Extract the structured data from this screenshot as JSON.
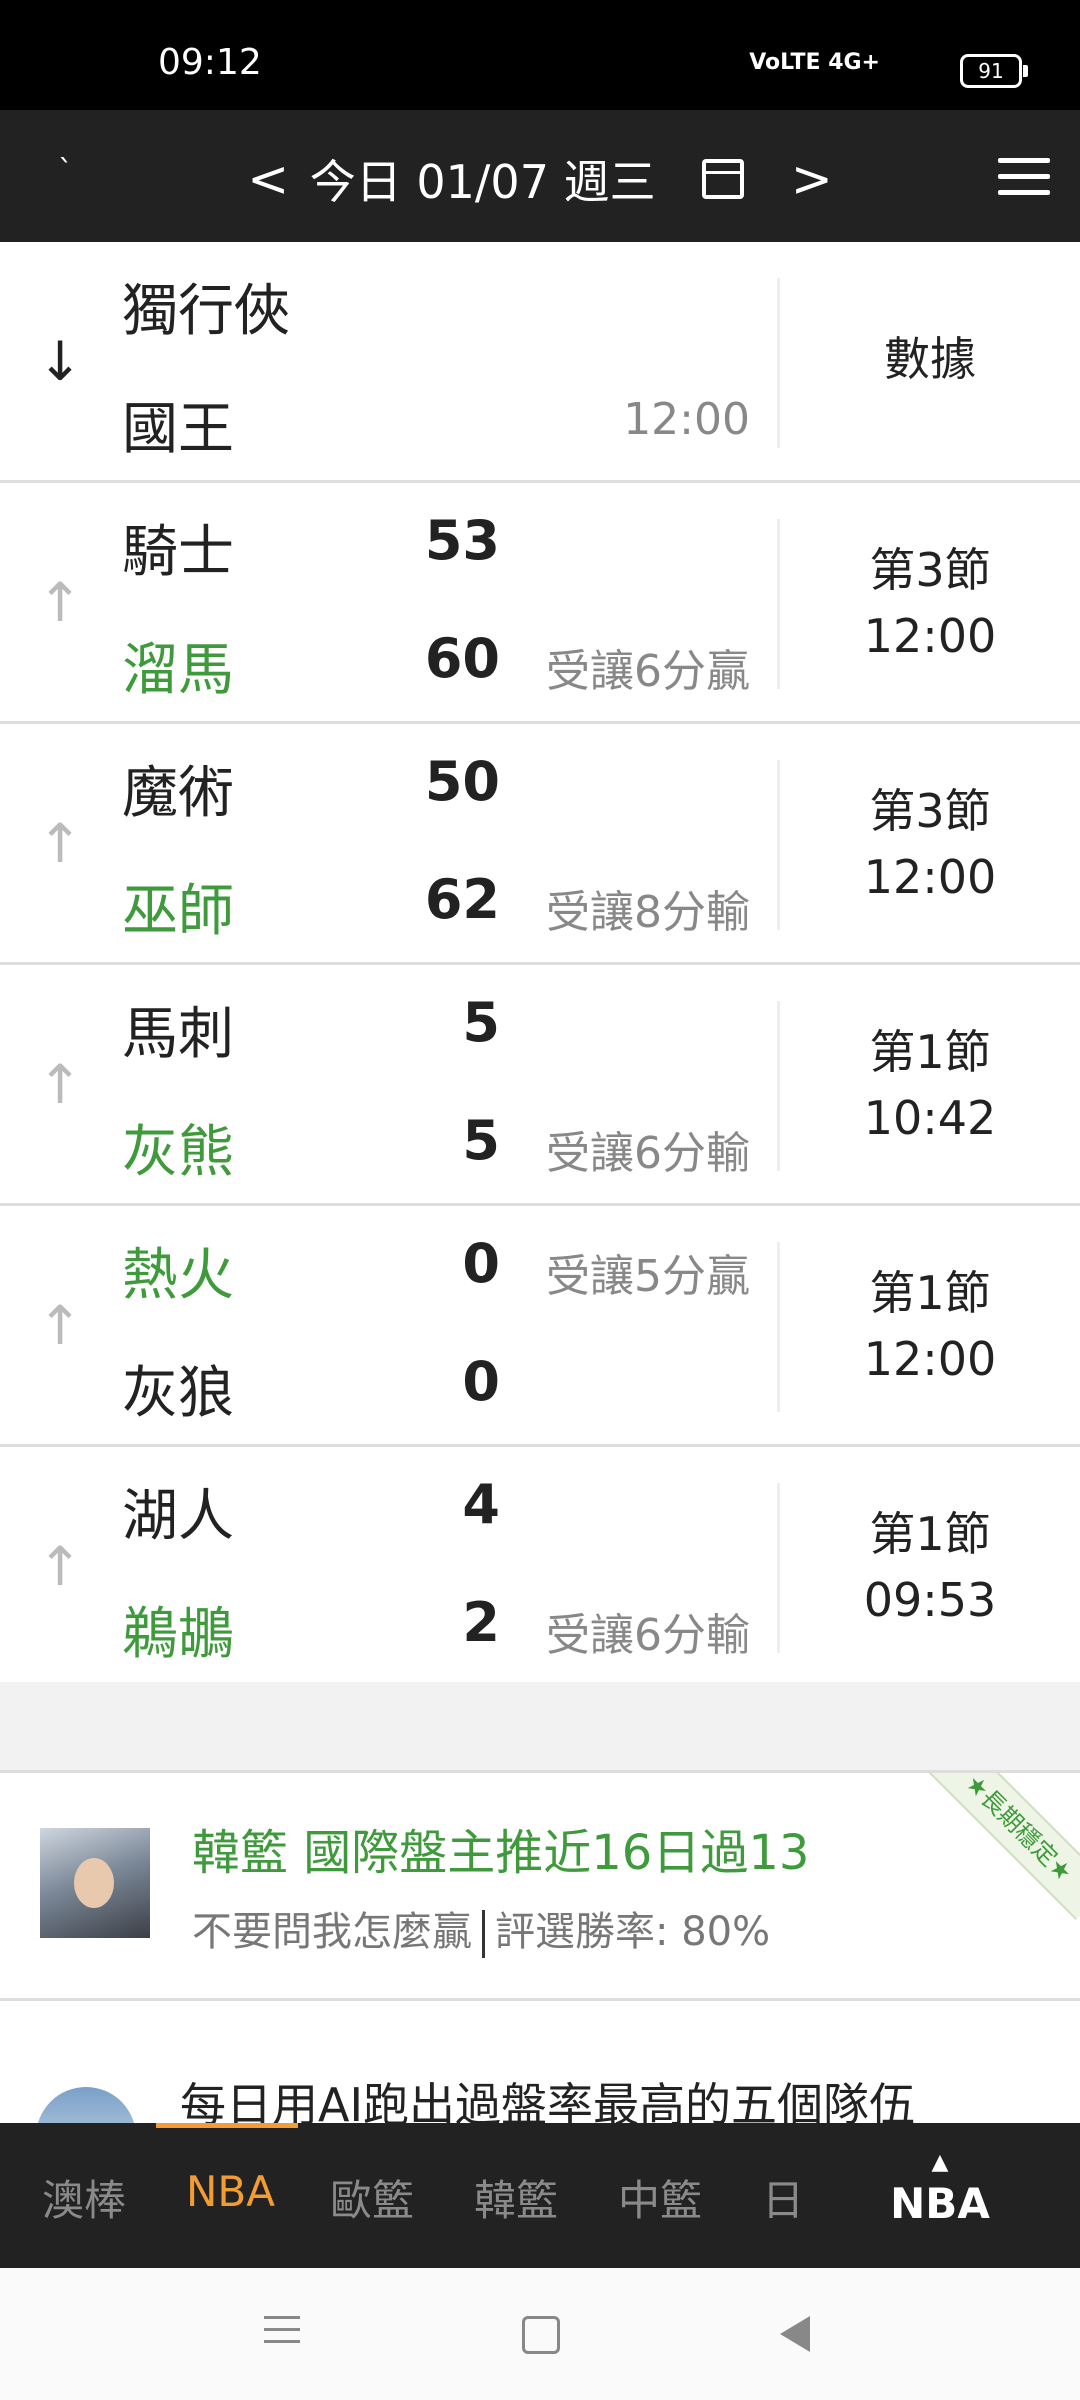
{
  "status_bar": {
    "time": "09:12",
    "network": "VoLTE 4G+",
    "battery": "91"
  },
  "header": {
    "prev": "<",
    "date_label": "今日 01/07 週三",
    "next": ">"
  },
  "games": [
    {
      "home": "獨行俠",
      "away": "國王",
      "score1": "",
      "score2": "",
      "note1": "",
      "note2": "12:00",
      "status_line1": "數據",
      "status_line2": "",
      "arrow": "↓",
      "green_team": 0
    },
    {
      "home": "騎士",
      "away": "溜馬",
      "score1": "53",
      "score2": "60",
      "note1": "",
      "note2": "受讓6分贏",
      "status_line1": "第3節",
      "status_line2": "12:00",
      "arrow": "↑",
      "green_team": 2
    },
    {
      "home": "魔術",
      "away": "巫師",
      "score1": "50",
      "score2": "62",
      "note1": "",
      "note2": "受讓8分輸",
      "status_line1": "第3節",
      "status_line2": "12:00",
      "arrow": "↑",
      "green_team": 2
    },
    {
      "home": "馬刺",
      "away": "灰熊",
      "score1": "5",
      "score2": "5",
      "note1": "",
      "note2": "受讓6分輸",
      "status_line1": "第1節",
      "status_line2": "10:42",
      "arrow": "↑",
      "green_team": 2
    },
    {
      "home": "熱火",
      "away": "灰狼",
      "score1": "0",
      "score2": "0",
      "note1": "受讓5分贏",
      "note2": "",
      "status_line1": "第1節",
      "status_line2": "12:00",
      "arrow": "↑",
      "green_team": 1
    },
    {
      "home": "湖人",
      "away": "鵜鶘",
      "score1": "4",
      "score2": "2",
      "note1": "",
      "note2": "受讓6分輸",
      "status_line1": "第1節",
      "status_line2": "09:53",
      "arrow": "↑",
      "green_team": 2
    }
  ],
  "tipster": {
    "title": "韓籃 國際盤主推近16日過13",
    "tagline": "不要問我怎麼贏",
    "win_rate": "評選勝率: 80%",
    "ribbon": "★長期穩定★"
  },
  "article": {
    "title": "每日用AI跑出過盤率最高的五個隊伍"
  },
  "tabs": [
    "澳棒",
    "NBA",
    "歐籃",
    "韓籃",
    "中籃",
    "日"
  ],
  "active_tab": "NBA",
  "current_league": "NBA",
  "colors": {
    "accent": "#f39c34",
    "green": "#3f9a3c",
    "header_bg": "#222222"
  }
}
